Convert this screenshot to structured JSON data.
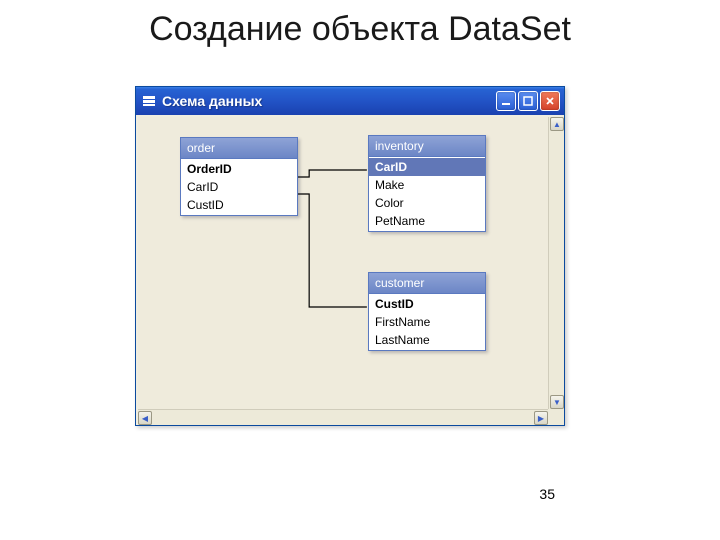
{
  "slide": {
    "title": "Создание объекта DataSet",
    "page_number": "35"
  },
  "window": {
    "title": "Схема данных"
  },
  "tables": {
    "order": {
      "title": "order",
      "fields": [
        "OrderID",
        "CarID",
        "CustID"
      ]
    },
    "inventory": {
      "title": "inventory",
      "fields": [
        "CarID",
        "Make",
        "Color",
        "PetName"
      ]
    },
    "customer": {
      "title": "customer",
      "fields": [
        "CustID",
        "FirstName",
        "LastName"
      ]
    }
  }
}
